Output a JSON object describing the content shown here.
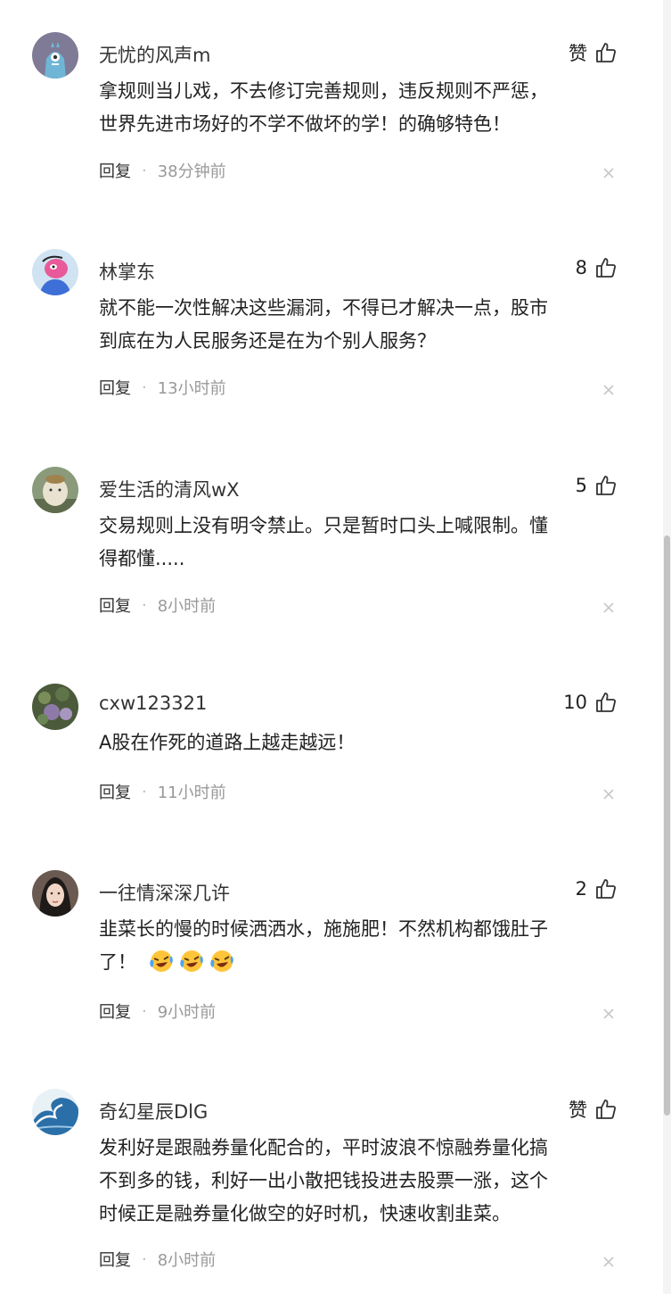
{
  "comments": [
    {
      "user": "无忧的风声m",
      "likes": "赞",
      "lines": [
        "拿规则当儿戏，不去修订完善规则，违反规则不严惩，",
        "世界先进市场好的不学不做坏的学！的确够特色！"
      ],
      "reply": "回复",
      "time": "38分钟前",
      "avatar": "avatar-robot-icon"
    },
    {
      "user": "林掌东",
      "likes": "8",
      "lines": [
        "就不能一次性解决这些漏洞，不得已才解决一点，股市",
        "到底在为人民服务还是在为个别人服务？"
      ],
      "reply": "回复",
      "time": "13小时前",
      "avatar": "avatar-cartoon-icon"
    },
    {
      "user": "爱生活的清风wX",
      "likes": "5",
      "lines": [
        "交易规则上没有明令禁止。只是暂时口头上喊限制。懂",
        "得都懂....."
      ],
      "reply": "回复",
      "time": "8小时前",
      "avatar": "avatar-photo-icon"
    },
    {
      "user": "cxw123321",
      "likes": "10",
      "lines": [
        "A股在作死的道路上越走越远！"
      ],
      "reply": "回复",
      "time": "11小时前",
      "avatar": "avatar-flowers-icon"
    },
    {
      "user": "一往情深深几许",
      "likes": "2",
      "lines": [
        "韭菜长的慢的时候洒洒水，施施肥！不然机构都饿肚子",
        "了！"
      ],
      "emojis": [
        "laughing-crying-emoji",
        "laughing-crying-emoji",
        "laughing-crying-emoji"
      ],
      "reply": "回复",
      "time": "9小时前",
      "avatar": "avatar-portrait-icon"
    },
    {
      "user": "奇幻星辰DlG",
      "likes": "赞",
      "lines": [
        "发利好是跟融券量化配合的，平时波浪不惊融券量化搞",
        "不到多的钱，利好一出小散把钱投进去股票一涨，这个",
        "时候正是融券量化做空的好时机，快速收割韭菜。"
      ],
      "reply": "回复",
      "time": "8小时前",
      "avatar": "avatar-wave-icon"
    }
  ],
  "meta_separator": "·"
}
